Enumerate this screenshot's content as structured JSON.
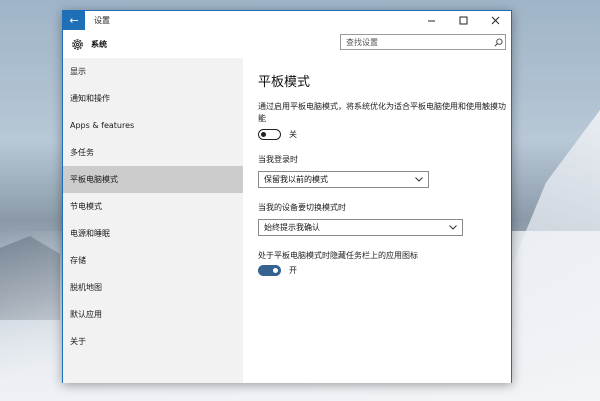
{
  "window": {
    "title": "设置",
    "back_icon": "back-arrow-icon",
    "controls": [
      "minimize-icon",
      "maximize-icon",
      "close-icon"
    ]
  },
  "header": {
    "title": "系统",
    "icon": "gear-icon",
    "search_placeholder": "查找设置"
  },
  "sidebar": {
    "items": [
      {
        "label": "显示"
      },
      {
        "label": "通知和操作"
      },
      {
        "label": "Apps & features"
      },
      {
        "label": "多任务"
      },
      {
        "label": "平板电脑模式",
        "selected": true
      },
      {
        "label": "节电模式"
      },
      {
        "label": "电源和睡眠"
      },
      {
        "label": "存储"
      },
      {
        "label": "脱机地图"
      },
      {
        "label": "默认应用"
      },
      {
        "label": "关于"
      }
    ]
  },
  "content": {
    "title": "平板模式",
    "description": "通过启用平板电脑模式，将系统优化为适合平板电脑使用和使用触摸功能",
    "tablet_toggle": {
      "state": "off",
      "label": "关"
    },
    "login_label": "当我登录时",
    "login_select": "保留我以前的模式",
    "switch_label": "当我的设备要切换模式时",
    "switch_select": "始终提示我确认",
    "hide_icons_label": "处于平板电脑模式时隐藏任务栏上的应用图标",
    "hide_icons_toggle": {
      "state": "on",
      "label": "开"
    }
  },
  "colors": {
    "accent": "#1e6eb8",
    "toggle_on": "#35628f",
    "selected_nav": "#cccccc",
    "sidebar_bg": "#f2f2f2"
  }
}
